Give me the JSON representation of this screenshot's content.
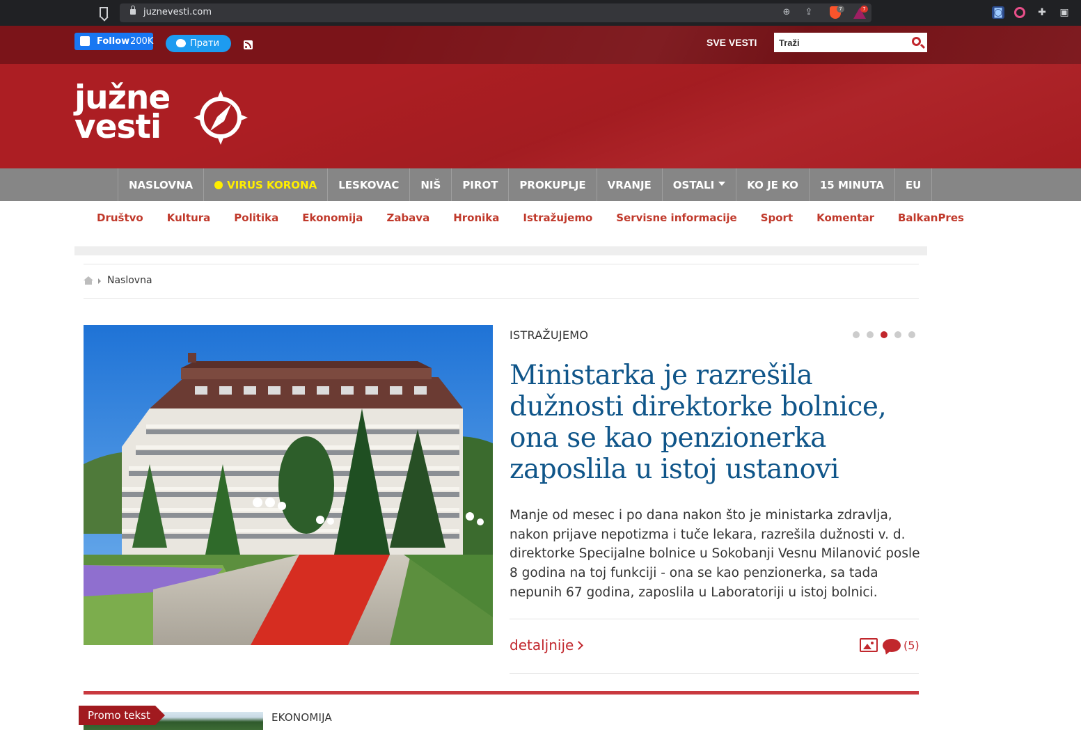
{
  "browser": {
    "url": "juznevesti.com",
    "brave_badge": "7",
    "rewards_badge": "7"
  },
  "header": {
    "fb_follow_label": "Follow",
    "fb_follow_count": "200K",
    "twitter_follow_label": "Прати",
    "sve_vesti": "SVE VESTI",
    "search_placeholder": "Traži",
    "logo_line1": "južne",
    "logo_line2": "vesti"
  },
  "main_nav": [
    {
      "label": "NASLOVNA"
    },
    {
      "label": "VIRUS KORONA"
    },
    {
      "label": "LESKOVAC"
    },
    {
      "label": "NIŠ"
    },
    {
      "label": "PIROT"
    },
    {
      "label": "PROKUPLJE"
    },
    {
      "label": "VRANJE"
    },
    {
      "label": "OSTALI"
    },
    {
      "label": "KO JE KO"
    },
    {
      "label": "15 MINUTA"
    },
    {
      "label": "EU"
    }
  ],
  "sub_nav": [
    "Društvo",
    "Kultura",
    "Politika",
    "Ekonomija",
    "Zabava",
    "Hronika",
    "Istražujemo",
    "Servisne informacije",
    "Sport",
    "Komentar",
    "BalkanPres"
  ],
  "breadcrumb": {
    "current": "Naslovna"
  },
  "featured": {
    "category": "ISTRAŽUJEMO",
    "slider_active_index": 3,
    "slider_total": 5,
    "headline": "Ministarka je razrešila dužnosti direktorke bolnice, ona se kao penzionerka zaposlila u istoj ustanovi",
    "lead": "Manje od mesec i po dana nakon što je ministarka zdravlja, nakon prijave nepotizma i tuče lekara, razrešila dužnosti v. d. direktorke Specijalne bolnice u Sokobanji Vesnu Milanović posle 8 godina na toj funkciji - ona se kao penzionerka, sa tada nepunih 67 godina, zaposlila u Laboratoriji u istoj bolnici.",
    "more_label": "detaljnije",
    "comment_count": "(5)"
  },
  "next_section": {
    "promo_label": "Promo tekst",
    "category": "EKONOMIJA"
  },
  "colors": {
    "brand_red": "#ac1e23",
    "top_bar": "#7b1419",
    "headline_blue": "#0f5589",
    "accent_red": "#c1272d",
    "nav_grey": "#868686",
    "corona_yellow": "#ffee00"
  }
}
